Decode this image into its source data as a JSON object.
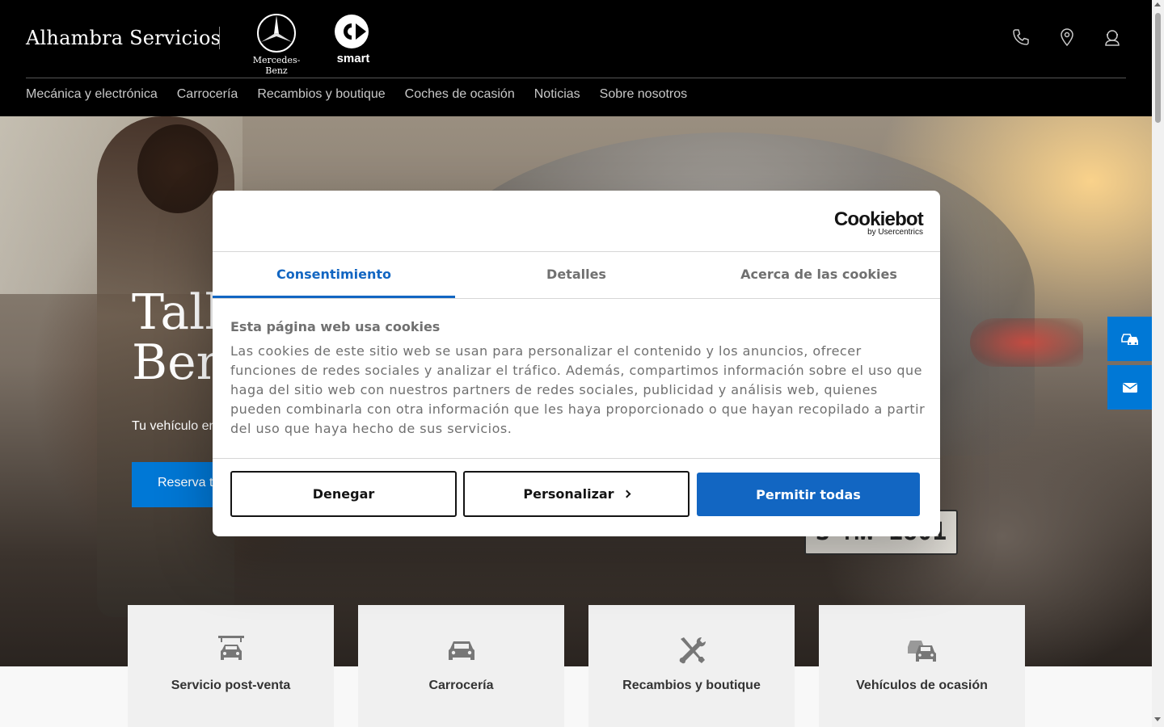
{
  "header": {
    "brand_name": "Alhambra Servicios",
    "mercedes_label": "Mercedes-Benz",
    "smart_label": "smart",
    "icons": [
      "phone-icon",
      "location-icon",
      "contact-icon"
    ]
  },
  "nav": {
    "items": [
      {
        "label": "Mecánica y electrónica"
      },
      {
        "label": "Carrocería"
      },
      {
        "label": "Recambios y boutique"
      },
      {
        "label": "Coches de ocasión"
      },
      {
        "label": "Noticias"
      },
      {
        "label": "Sobre nosotros"
      }
    ]
  },
  "hero": {
    "title": "Taller Mercedes-\nBenz",
    "subtitle": "Tu vehículo en las mejores manos",
    "cta_label": "Reserva tu cita",
    "plate_text": "S·MW 1801"
  },
  "side_buttons": [
    "cars-icon",
    "mail-icon"
  ],
  "cards": [
    {
      "label": "Servicio post-venta",
      "icon": "car-lift-icon"
    },
    {
      "label": "Carrocería",
      "icon": "car-front-icon"
    },
    {
      "label": "Recambios y boutique",
      "icon": "tools-icon"
    },
    {
      "label": "Vehículos de ocasión",
      "icon": "cars-icon"
    }
  ],
  "cookie_dialog": {
    "logo_main": "Cookiebot",
    "logo_sub": "by Usercentrics",
    "tabs": [
      {
        "label": "Consentimiento",
        "active": true
      },
      {
        "label": "Detalles",
        "active": false
      },
      {
        "label": "Acerca de las cookies",
        "active": false
      }
    ],
    "heading": "Esta página web usa cookies",
    "body": "Las cookies de este sitio web se usan para personalizar el contenido y los anuncios, ofrecer funciones de redes sociales y analizar el tráfico. Además, compartimos información sobre el uso que haga del sitio web con nuestros partners de redes sociales, publicidad y análisis web, quienes pueden combinarla con otra información que les haya proporcionado o que hayan recopilado a partir del uso que haya hecho de sus servicios.",
    "deny_label": "Denegar",
    "customize_label": "Personalizar",
    "allow_label": "Permitir todas"
  },
  "colors": {
    "accent_blue": "#0078d6",
    "cookiebot_blue": "#1266c2",
    "header_bg": "#000000"
  }
}
